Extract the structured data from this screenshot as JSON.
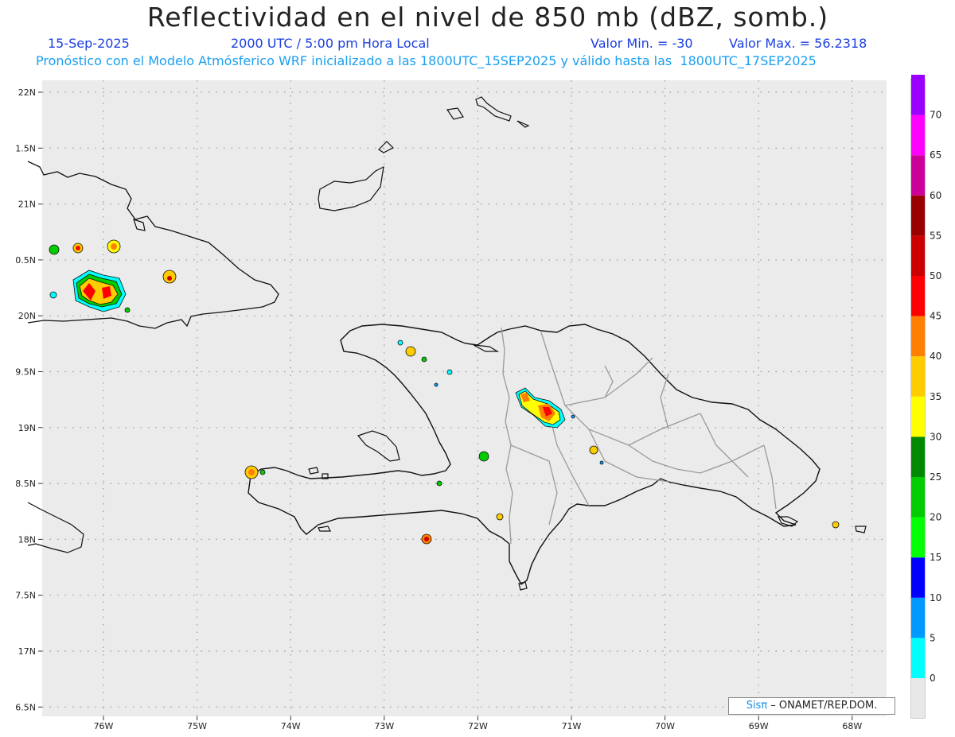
{
  "header": {
    "title": "Reflectividad en el nivel de 850 mb (dBZ, somb.)",
    "date": "15-Sep-2025",
    "time": "2000 UTC / 5:00 pm Hora Local",
    "valmin": "Valor Min. = -30",
    "valmax": "Valor Max. = 56.2318",
    "forecast": "Pronóstico con el Modelo Atmósferico WRF inicializado a las 1800UTC_15SEP2025 y válido hasta las  1800UTC_17SEP2025"
  },
  "map": {
    "lat_labels": [
      "22N",
      "1.5N",
      "21N",
      "0.5N",
      "20N",
      "9.5N",
      "19N",
      "8.5N",
      "18N",
      "7.5N",
      "17N",
      "6.5N"
    ],
    "lon_labels": [
      "76W",
      "75W",
      "74W",
      "73W",
      "72W",
      "71W",
      "70W",
      "69W",
      "68W"
    ],
    "background_color": "#ebebeb"
  },
  "colorbar": {
    "labels": [
      "0",
      "5",
      "10",
      "15",
      "20",
      "25",
      "30",
      "35",
      "40",
      "45",
      "50",
      "55",
      "60",
      "65",
      "70"
    ],
    "colors": [
      "#00ffff",
      "#0099ff",
      "#0000ff",
      "#00ff00",
      "#00cc00",
      "#008800",
      "#ffff00",
      "#ffcc00",
      "#ff7f00",
      "#ff0000",
      "#cc0000",
      "#990000",
      "#cc0099",
      "#ff00ff",
      "#9900ff"
    ]
  },
  "credit": {
    "brand": "Sisπ",
    "rest": " – ONAMET/REP.DOM."
  }
}
